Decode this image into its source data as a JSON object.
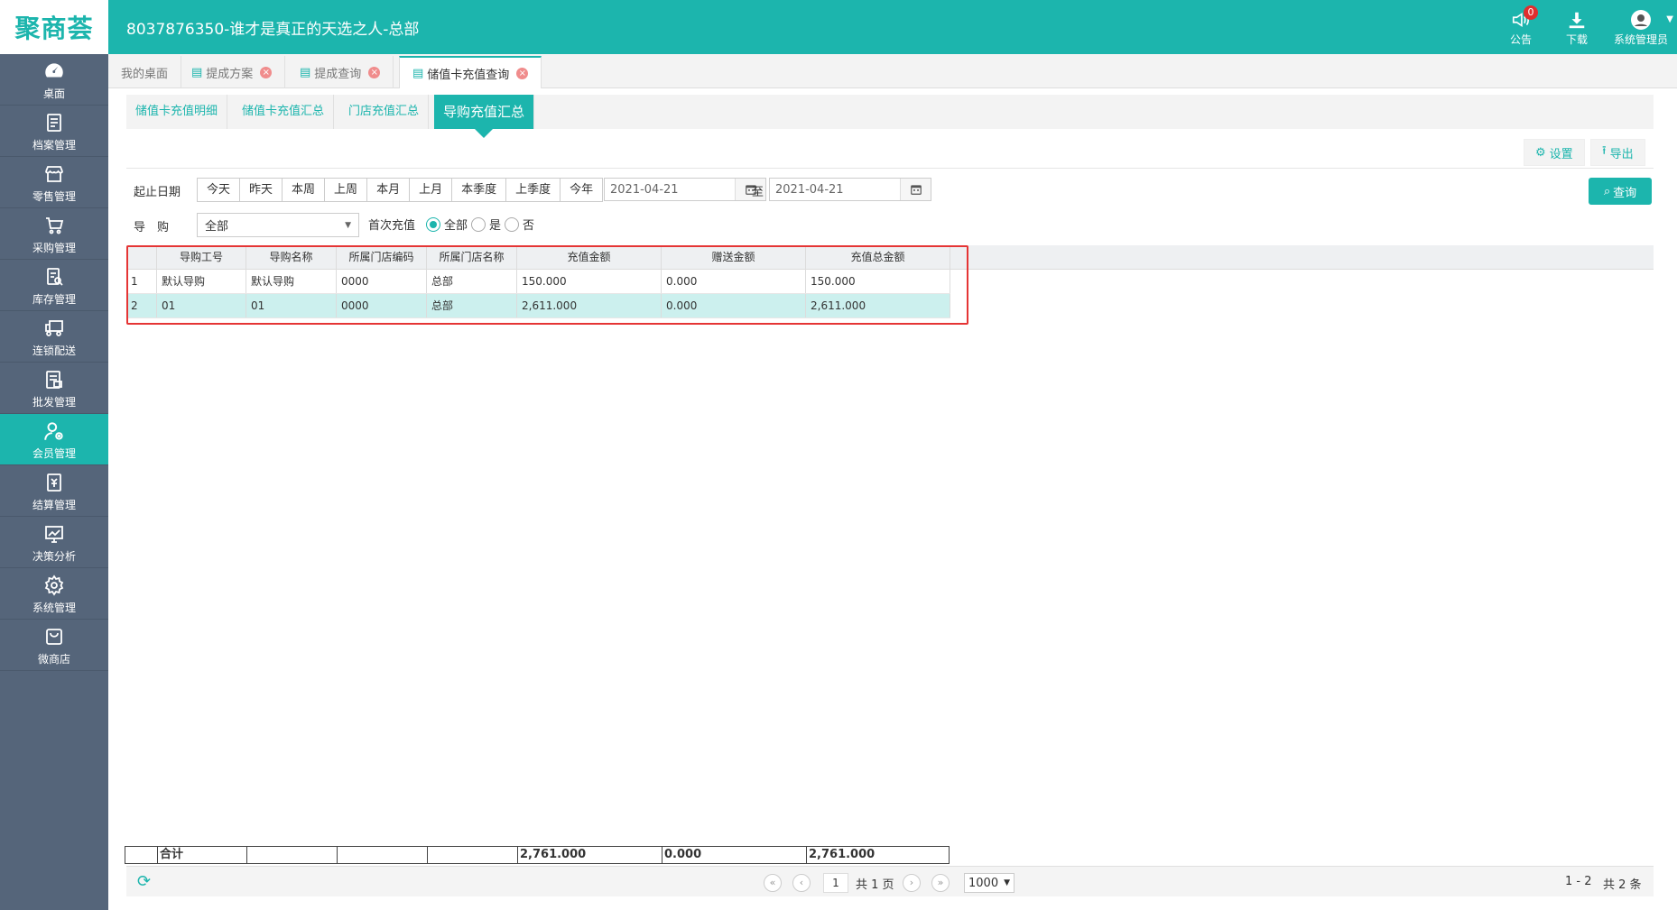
{
  "header": {
    "logo": "聚商荟",
    "title": "8037876350-谁才是真正的天选之人-总部",
    "notice_label": "公告",
    "notice_count": "0",
    "download_label": "下载",
    "user_label": "系统管理员"
  },
  "sidebar": {
    "items": [
      {
        "label": "桌面",
        "icon": "dashboard-icon"
      },
      {
        "label": "档案管理",
        "icon": "archive-icon"
      },
      {
        "label": "零售管理",
        "icon": "store-icon"
      },
      {
        "label": "采购管理",
        "icon": "cart-icon"
      },
      {
        "label": "库存管理",
        "icon": "inventory-icon"
      },
      {
        "label": "连锁配送",
        "icon": "truck-icon"
      },
      {
        "label": "批发管理",
        "icon": "wholesale-icon"
      },
      {
        "label": "会员管理",
        "icon": "member-icon"
      },
      {
        "label": "结算管理",
        "icon": "settlement-icon"
      },
      {
        "label": "决策分析",
        "icon": "chart-icon"
      },
      {
        "label": "系统管理",
        "icon": "gear-icon"
      },
      {
        "label": "微商店",
        "icon": "shop-bag-icon"
      }
    ],
    "active_index": 7
  },
  "tabs": [
    {
      "label": "我的桌面"
    },
    {
      "label": "提成方案"
    },
    {
      "label": "提成查询"
    },
    {
      "label": "储值卡充值查询"
    }
  ],
  "subtabs": [
    {
      "label": "储值卡充值明细"
    },
    {
      "label": "储值卡充值汇总"
    },
    {
      "label": "门店充值汇总"
    },
    {
      "label": "导购充值汇总"
    }
  ],
  "toolbar": {
    "settings_label": "设置",
    "export_label": "导出"
  },
  "filters": {
    "date_label": "起止日期",
    "quick": [
      "今天",
      "昨天",
      "本周",
      "上周",
      "本月",
      "上月",
      "本季度",
      "上季度",
      "今年"
    ],
    "start_date": "2021-04-21",
    "to_label": "至",
    "end_date": "2021-04-21",
    "query_label": "查询",
    "guide_label": "导　购",
    "guide_value": "全部",
    "first_charge_label": "首次充值",
    "radio_all": "全部",
    "radio_yes": "是",
    "radio_no": "否"
  },
  "grid": {
    "columns": [
      "导购工号",
      "导购名称",
      "所属门店编码",
      "所属门店名称",
      "充值金额",
      "赠送金额",
      "充值总金额"
    ],
    "rows": [
      {
        "idx": "1",
        "cells": [
          "默认导购",
          "默认导购",
          "0000",
          "总部",
          "150.000",
          "0.000",
          "150.000"
        ]
      },
      {
        "idx": "2",
        "cells": [
          "01",
          "01",
          "0000",
          "总部",
          "2,611.000",
          "0.000",
          "2,611.000"
        ]
      }
    ],
    "total": {
      "label": "合计",
      "charge": "2,761.000",
      "gift": "0.000",
      "sum": "2,761.000"
    }
  },
  "pager": {
    "page": "1",
    "total_pages": "共 1 页",
    "page_size": "1000",
    "range": "1 - 2",
    "count": "共 2 条"
  },
  "colors": {
    "accent": "#1cb5ad",
    "sidebar": "#55657a",
    "highlight": "#e53535"
  }
}
